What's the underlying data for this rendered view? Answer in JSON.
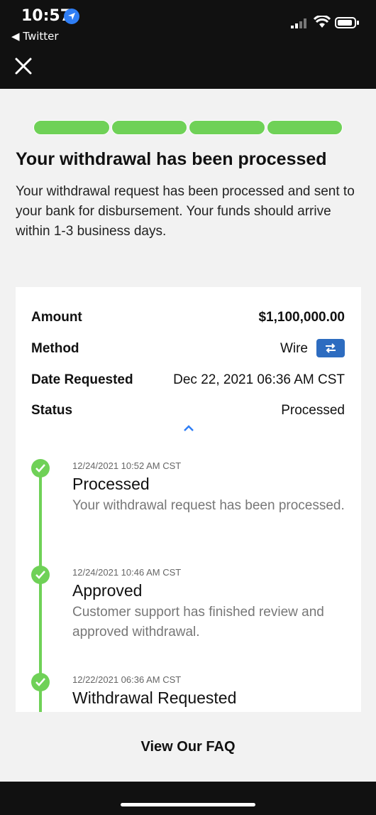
{
  "status_bar": {
    "time": "10:57",
    "back_app": "◀ Twitter"
  },
  "colors": {
    "accent_green": "#6fd157",
    "badge_blue": "#2d6cc0",
    "header_bg": "#111111"
  },
  "progress": {
    "steps_total": 4,
    "steps_complete": 4
  },
  "page": {
    "title": "Your withdrawal has been processed",
    "description": "Your withdrawal request has been processed and sent to your bank for disbursement. Your funds should arrive within 1-3 business days."
  },
  "details": {
    "amount_label": "Amount",
    "amount_value": "$1,100,000.00",
    "method_label": "Method",
    "method_value": "Wire",
    "date_label": "Date Requested",
    "date_value": "Dec 22, 2021 06:36 AM CST",
    "status_label": "Status",
    "status_value": "Processed"
  },
  "timeline": [
    {
      "time": "12/24/2021 10:52 AM CST",
      "title": "Processed",
      "desc": "Your withdrawal request has been processed."
    },
    {
      "time": "12/24/2021 10:46 AM CST",
      "title": "Approved",
      "desc": "Customer support has finished review and approved withdrawal."
    },
    {
      "time": "12/22/2021 06:36 AM CST",
      "title": "Withdrawal Requested",
      "desc": ""
    }
  ],
  "footer": {
    "faq_label": "View Our FAQ"
  },
  "icons": [
    "location-arrow-icon",
    "signal-icon",
    "wifi-icon",
    "battery-icon",
    "close-icon",
    "transfer-icon",
    "chevron-up-icon",
    "check-icon"
  ]
}
